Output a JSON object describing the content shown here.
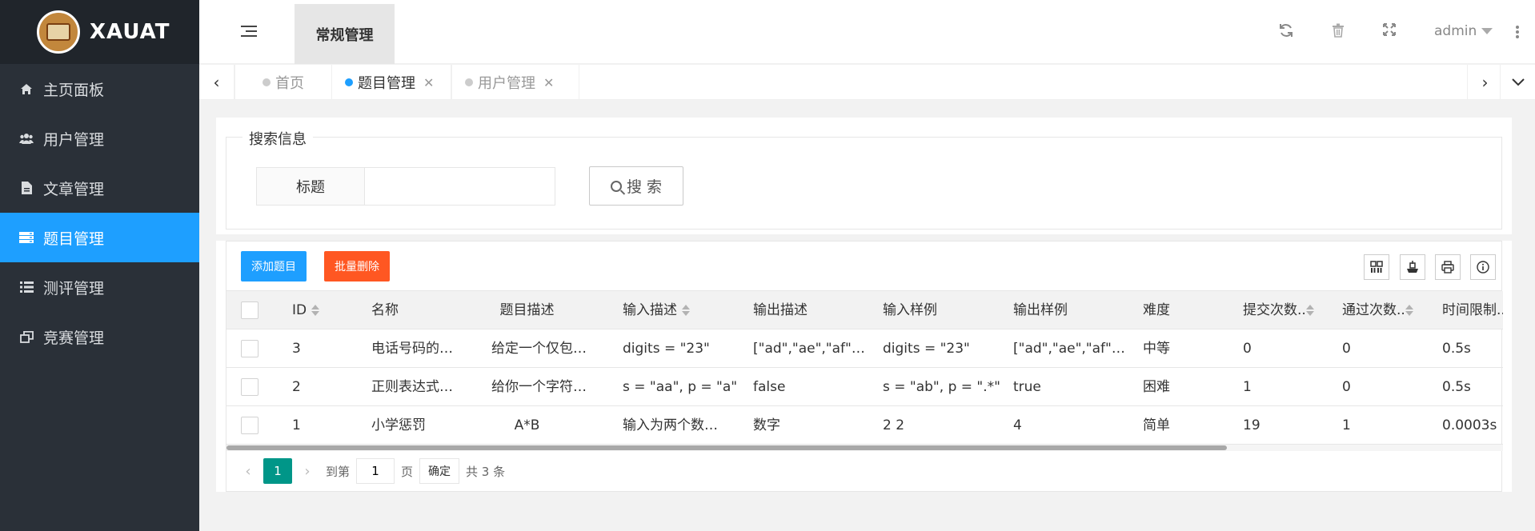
{
  "brand": {
    "name": "XAUAT"
  },
  "sidebar": {
    "items": [
      {
        "label": "主页面板",
        "icon": "home-icon"
      },
      {
        "label": "用户管理",
        "icon": "users-icon"
      },
      {
        "label": "文章管理",
        "icon": "file-icon"
      },
      {
        "label": "题目管理",
        "icon": "server-icon",
        "active": true
      },
      {
        "label": "测评管理",
        "icon": "list-icon"
      },
      {
        "label": "竞赛管理",
        "icon": "window-restore-icon"
      }
    ]
  },
  "header": {
    "tab_label": "常规管理",
    "user": "admin"
  },
  "tabs": [
    {
      "label": "首页",
      "closable": false
    },
    {
      "label": "题目管理",
      "closable": true,
      "active": true
    },
    {
      "label": "用户管理",
      "closable": true
    }
  ],
  "search": {
    "legend": "搜索信息",
    "field_label": "标题",
    "field_value": "",
    "field_placeholder": "",
    "button_label": "搜 索"
  },
  "toolbar": {
    "add_label": "添加题目",
    "delete_label": "批量删除"
  },
  "table": {
    "columns": [
      "ID",
      "名称",
      "题目描述",
      "输入描述",
      "输出描述",
      "输入样例",
      "输出样例",
      "难度",
      "提交次数..",
      "通过次数..",
      "时间限制..."
    ],
    "rows": [
      [
        "3",
        "电话号码的…",
        "给定一个仅包…",
        "digits = \"23\"",
        "[\"ad\",\"ae\",\"af\"…",
        "digits = \"23\"",
        "[\"ad\",\"ae\",\"af\"…",
        "中等",
        "0",
        "0",
        "0.5s"
      ],
      [
        "2",
        "正则表达式…",
        "给你一个字符…",
        "s = \"aa\", p = \"a\"",
        "false",
        "s = \"ab\", p = \".*\"",
        "true",
        "困难",
        "1",
        "0",
        "0.5s"
      ],
      [
        "1",
        "小学惩罚",
        "A*B",
        "输入为两个数…",
        "数字",
        "2 2",
        "4",
        "简单",
        "19",
        "1",
        "0.0003s"
      ]
    ]
  },
  "pager": {
    "current": "1",
    "goto_label": "到第",
    "goto_value": "1",
    "page_unit": "页",
    "confirm_label": "确定",
    "total_label": "共 3 条"
  },
  "colors": {
    "sidebar_bg": "#2a3038",
    "accent": "#1e9fff",
    "danger": "#ff5722",
    "pager_active": "#009688"
  }
}
